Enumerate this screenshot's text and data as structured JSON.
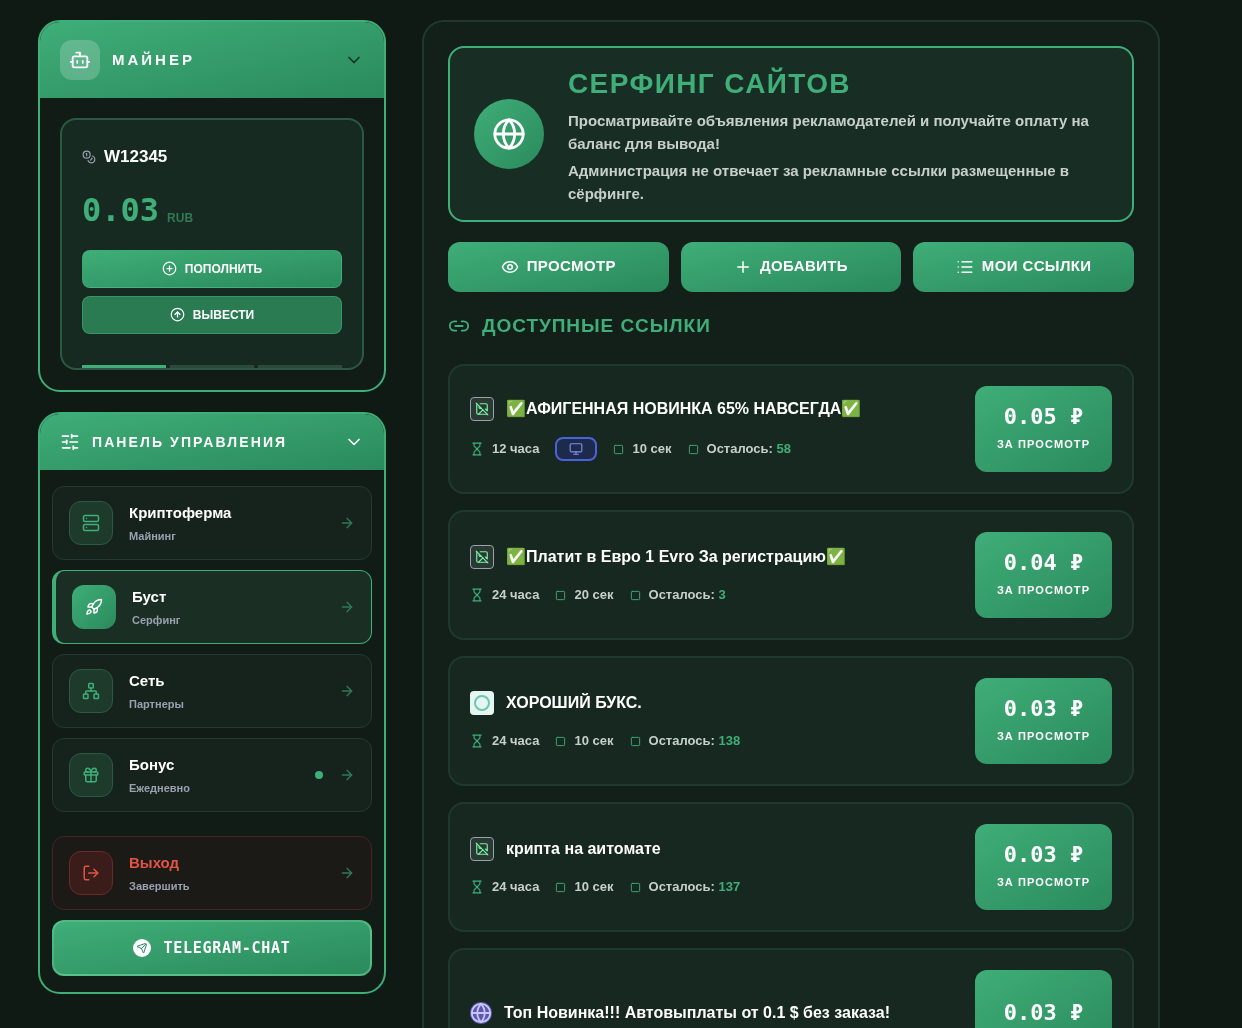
{
  "miner": {
    "title": "МАЙНЕР",
    "expanded": true,
    "wallet_id": "W12345",
    "balance": "0.03",
    "currency": "RUB",
    "buttons": [
      {
        "kind": "deposit",
        "label": "ПОПОЛНИТЬ"
      },
      {
        "kind": "withdraw",
        "label": "ВЫВЕСТИ"
      }
    ],
    "pager": [
      {
        "selected": true
      },
      {
        "selected": false
      },
      {
        "selected": false
      }
    ]
  },
  "panel": {
    "title": "ПАНЕЛЬ УПРАВЛЕНИЯ",
    "expanded": true,
    "items": [
      {
        "kind": "farm",
        "title": "Криптоферма",
        "subtitle": "Майнинг",
        "selected": false,
        "dot": false
      },
      {
        "kind": "boost",
        "title": "Буст",
        "subtitle": "Серфинг",
        "selected": true,
        "dot": false
      },
      {
        "kind": "network",
        "title": "Сеть",
        "subtitle": "Партнеры",
        "selected": false,
        "dot": false
      },
      {
        "kind": "bonus",
        "title": "Бонус",
        "subtitle": "Ежедневно",
        "selected": false,
        "dot": true
      },
      {
        "kind": "exit",
        "title": "Выход",
        "subtitle": "Завершить",
        "selected": false,
        "dot": false
      }
    ],
    "telegram": "TELEGRAM-CHAT"
  },
  "hero": {
    "title": "СЕРФИНГ САЙТОВ",
    "lines": [
      "Просматривайте объявления рекламодателей и получайте оплату на баланс для вывода!",
      "Администрация не отвечает за рекламные ссылки размещенные в сёрфинге."
    ]
  },
  "actions": [
    {
      "kind": "view",
      "label": "ПРОСМОТР"
    },
    {
      "kind": "add",
      "label": "ДОБАВИТЬ"
    },
    {
      "kind": "list",
      "label": "МОИ ССЫЛКИ"
    }
  ],
  "section_title": "ДОСТУПНЫЕ ССЫЛКИ",
  "links": [
    {
      "kind": "broken",
      "title": "✅АФИГЕННАЯ НОВИНКА 65% НАВСЕГДА✅",
      "duration": "12 часа",
      "desktop_only": true,
      "seconds": "10 сек",
      "remaining_label": "Осталось:",
      "remaining": "58",
      "price": "0.05 ₽",
      "price_label": "ЗА ПРОСМОТР"
    },
    {
      "kind": "broken",
      "title": "✅Платит в Евро 1 Evro За регистрацию✅",
      "duration": "24 часа",
      "desktop_only": false,
      "seconds": "20 сек",
      "remaining_label": "Осталось:",
      "remaining": "3",
      "price": "0.04 ₽",
      "price_label": "ЗА ПРОСМОТР"
    },
    {
      "kind": "logo",
      "title": "ХОРОШИЙ БУКС.",
      "duration": "24 часа",
      "desktop_only": false,
      "seconds": "10 сек",
      "remaining_label": "Осталось:",
      "remaining": "138",
      "price": "0.03 ₽",
      "price_label": "ЗА ПРОСМОТР"
    },
    {
      "kind": "broken",
      "title": "крипта на аитомате",
      "duration": "24 часа",
      "desktop_only": false,
      "seconds": "10 сек",
      "remaining_label": "Осталось:",
      "remaining": "137",
      "price": "0.03 ₽",
      "price_label": "ЗА ПРОСМОТР"
    },
    {
      "kind": "globe",
      "title": "Топ Новинка!!! Автовыплаты от 0.1 $ без заказа!",
      "price": "0.03 ₽"
    }
  ]
}
